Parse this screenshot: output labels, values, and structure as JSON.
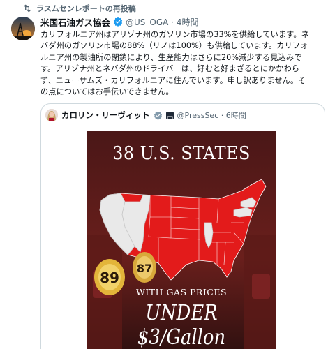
{
  "repost": {
    "icon": "repost-icon",
    "label": "ラスムセンレポートの再投稿"
  },
  "tweet": {
    "author_name": "米国石油ガス協会",
    "handle_time": "@US_OGA · 4時間",
    "lines": [
      "カリフォルニア州はアリゾナ州のガソリン市場の33%を供給しています。ネ",
      "バダ州のガソリン市場の88%（リノは100%）も供給しています。カリフォ",
      "ルニア州の製油所の閉鎖により、生産能力はさらに20%減少する見込みで",
      "す。アリゾナ州とネバダ州のドライバーは、好むと好まざるとにかかわら",
      "ず、ニューサムズ・カリフォルニアに住んでいます。申し訳ありません。そ",
      "の点についてはお手伝いできません。"
    ]
  },
  "quote": {
    "author_name": "カロリン・リーヴィット",
    "handle_time": "@PressSec · 6時間",
    "image": {
      "title": "38 U.S. STATES",
      "subtitle": "WITH GAS PRICES",
      "price_line": "UNDER $3/Gallon",
      "pump_number_left": "89",
      "pump_number_right": "87",
      "highlight_color": "#e31b1b",
      "other_color": "#e9e9e9"
    }
  },
  "colors": {
    "accent": "#1d9bf0",
    "text": "#0f1419",
    "muted": "#536471",
    "border": "#cfd9de"
  }
}
